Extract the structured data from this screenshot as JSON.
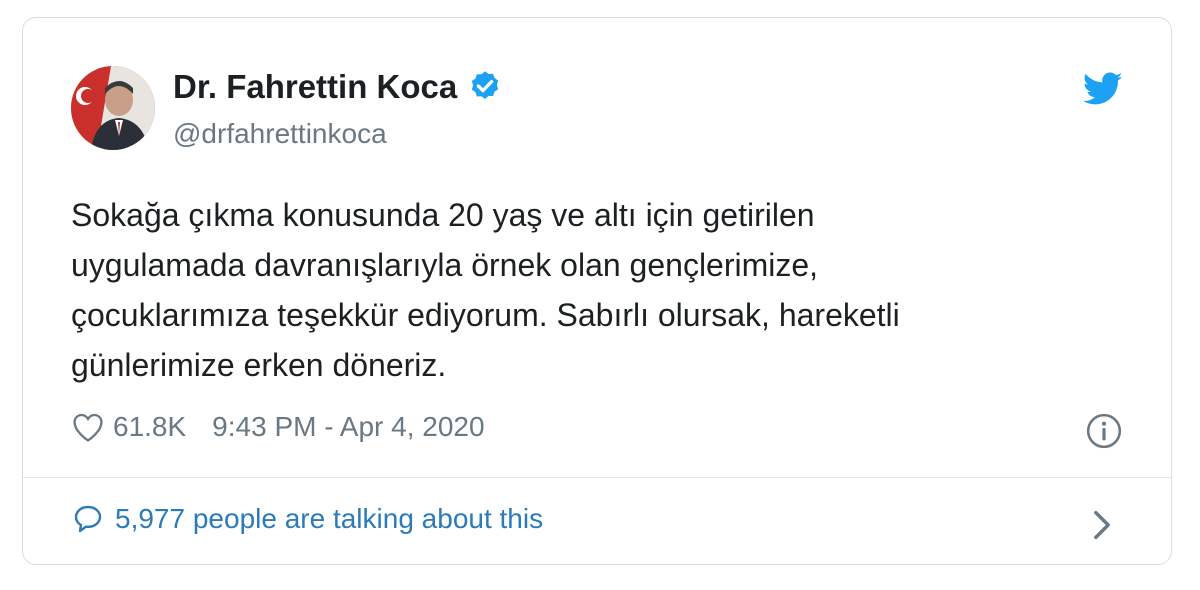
{
  "tweet": {
    "author": {
      "name": "Dr. Fahrettin Koca",
      "handle": "@drfahrettinkoca",
      "verified": true
    },
    "text_lines": [
      "Sokağa çıkma konusunda 20 yaş ve altı için getirilen",
      "uygulamada davranışlarıyla örnek olan gençlerimize,",
      "çocuklarımıza teşekkür ediyorum. Sabırlı olursak, hareketli",
      "günlerimize erken döneriz."
    ],
    "likes": "61.8K",
    "timestamp": "9:43 PM - Apr 4, 2020",
    "conversation": "5,977 people are talking about this"
  },
  "icons": {
    "brand": "twitter-bird-icon",
    "verified": "verified-badge-icon",
    "like": "heart-icon",
    "info": "info-icon",
    "reply": "speech-bubble-icon",
    "more": "chevron-right-icon"
  },
  "colors": {
    "twitter_blue": "#1da1f2",
    "link_blue": "#2b7bb9",
    "text": "#1c2022",
    "muted": "#697882",
    "border": "#d6dde3"
  }
}
